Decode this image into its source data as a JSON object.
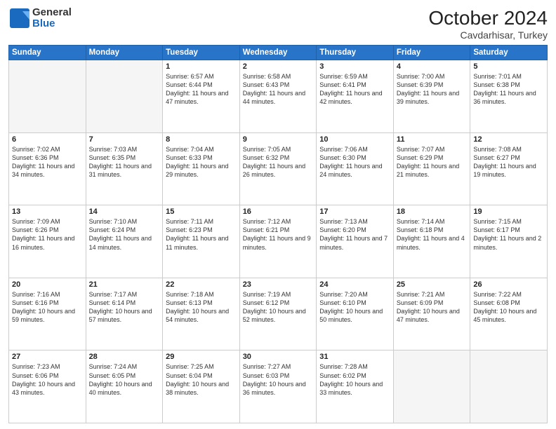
{
  "header": {
    "logo_general": "General",
    "logo_blue": "Blue",
    "month_title": "October 2024",
    "location": "Cavdarhisar, Turkey"
  },
  "weekdays": [
    "Sunday",
    "Monday",
    "Tuesday",
    "Wednesday",
    "Thursday",
    "Friday",
    "Saturday"
  ],
  "weeks": [
    [
      {
        "day": "",
        "sunrise": "",
        "sunset": "",
        "daylight": ""
      },
      {
        "day": "",
        "sunrise": "",
        "sunset": "",
        "daylight": ""
      },
      {
        "day": "1",
        "sunrise": "Sunrise: 6:57 AM",
        "sunset": "Sunset: 6:44 PM",
        "daylight": "Daylight: 11 hours and 47 minutes."
      },
      {
        "day": "2",
        "sunrise": "Sunrise: 6:58 AM",
        "sunset": "Sunset: 6:43 PM",
        "daylight": "Daylight: 11 hours and 44 minutes."
      },
      {
        "day": "3",
        "sunrise": "Sunrise: 6:59 AM",
        "sunset": "Sunset: 6:41 PM",
        "daylight": "Daylight: 11 hours and 42 minutes."
      },
      {
        "day": "4",
        "sunrise": "Sunrise: 7:00 AM",
        "sunset": "Sunset: 6:39 PM",
        "daylight": "Daylight: 11 hours and 39 minutes."
      },
      {
        "day": "5",
        "sunrise": "Sunrise: 7:01 AM",
        "sunset": "Sunset: 6:38 PM",
        "daylight": "Daylight: 11 hours and 36 minutes."
      }
    ],
    [
      {
        "day": "6",
        "sunrise": "Sunrise: 7:02 AM",
        "sunset": "Sunset: 6:36 PM",
        "daylight": "Daylight: 11 hours and 34 minutes."
      },
      {
        "day": "7",
        "sunrise": "Sunrise: 7:03 AM",
        "sunset": "Sunset: 6:35 PM",
        "daylight": "Daylight: 11 hours and 31 minutes."
      },
      {
        "day": "8",
        "sunrise": "Sunrise: 7:04 AM",
        "sunset": "Sunset: 6:33 PM",
        "daylight": "Daylight: 11 hours and 29 minutes."
      },
      {
        "day": "9",
        "sunrise": "Sunrise: 7:05 AM",
        "sunset": "Sunset: 6:32 PM",
        "daylight": "Daylight: 11 hours and 26 minutes."
      },
      {
        "day": "10",
        "sunrise": "Sunrise: 7:06 AM",
        "sunset": "Sunset: 6:30 PM",
        "daylight": "Daylight: 11 hours and 24 minutes."
      },
      {
        "day": "11",
        "sunrise": "Sunrise: 7:07 AM",
        "sunset": "Sunset: 6:29 PM",
        "daylight": "Daylight: 11 hours and 21 minutes."
      },
      {
        "day": "12",
        "sunrise": "Sunrise: 7:08 AM",
        "sunset": "Sunset: 6:27 PM",
        "daylight": "Daylight: 11 hours and 19 minutes."
      }
    ],
    [
      {
        "day": "13",
        "sunrise": "Sunrise: 7:09 AM",
        "sunset": "Sunset: 6:26 PM",
        "daylight": "Daylight: 11 hours and 16 minutes."
      },
      {
        "day": "14",
        "sunrise": "Sunrise: 7:10 AM",
        "sunset": "Sunset: 6:24 PM",
        "daylight": "Daylight: 11 hours and 14 minutes."
      },
      {
        "day": "15",
        "sunrise": "Sunrise: 7:11 AM",
        "sunset": "Sunset: 6:23 PM",
        "daylight": "Daylight: 11 hours and 11 minutes."
      },
      {
        "day": "16",
        "sunrise": "Sunrise: 7:12 AM",
        "sunset": "Sunset: 6:21 PM",
        "daylight": "Daylight: 11 hours and 9 minutes."
      },
      {
        "day": "17",
        "sunrise": "Sunrise: 7:13 AM",
        "sunset": "Sunset: 6:20 PM",
        "daylight": "Daylight: 11 hours and 7 minutes."
      },
      {
        "day": "18",
        "sunrise": "Sunrise: 7:14 AM",
        "sunset": "Sunset: 6:18 PM",
        "daylight": "Daylight: 11 hours and 4 minutes."
      },
      {
        "day": "19",
        "sunrise": "Sunrise: 7:15 AM",
        "sunset": "Sunset: 6:17 PM",
        "daylight": "Daylight: 11 hours and 2 minutes."
      }
    ],
    [
      {
        "day": "20",
        "sunrise": "Sunrise: 7:16 AM",
        "sunset": "Sunset: 6:16 PM",
        "daylight": "Daylight: 10 hours and 59 minutes."
      },
      {
        "day": "21",
        "sunrise": "Sunrise: 7:17 AM",
        "sunset": "Sunset: 6:14 PM",
        "daylight": "Daylight: 10 hours and 57 minutes."
      },
      {
        "day": "22",
        "sunrise": "Sunrise: 7:18 AM",
        "sunset": "Sunset: 6:13 PM",
        "daylight": "Daylight: 10 hours and 54 minutes."
      },
      {
        "day": "23",
        "sunrise": "Sunrise: 7:19 AM",
        "sunset": "Sunset: 6:12 PM",
        "daylight": "Daylight: 10 hours and 52 minutes."
      },
      {
        "day": "24",
        "sunrise": "Sunrise: 7:20 AM",
        "sunset": "Sunset: 6:10 PM",
        "daylight": "Daylight: 10 hours and 50 minutes."
      },
      {
        "day": "25",
        "sunrise": "Sunrise: 7:21 AM",
        "sunset": "Sunset: 6:09 PM",
        "daylight": "Daylight: 10 hours and 47 minutes."
      },
      {
        "day": "26",
        "sunrise": "Sunrise: 7:22 AM",
        "sunset": "Sunset: 6:08 PM",
        "daylight": "Daylight: 10 hours and 45 minutes."
      }
    ],
    [
      {
        "day": "27",
        "sunrise": "Sunrise: 7:23 AM",
        "sunset": "Sunset: 6:06 PM",
        "daylight": "Daylight: 10 hours and 43 minutes."
      },
      {
        "day": "28",
        "sunrise": "Sunrise: 7:24 AM",
        "sunset": "Sunset: 6:05 PM",
        "daylight": "Daylight: 10 hours and 40 minutes."
      },
      {
        "day": "29",
        "sunrise": "Sunrise: 7:25 AM",
        "sunset": "Sunset: 6:04 PM",
        "daylight": "Daylight: 10 hours and 38 minutes."
      },
      {
        "day": "30",
        "sunrise": "Sunrise: 7:27 AM",
        "sunset": "Sunset: 6:03 PM",
        "daylight": "Daylight: 10 hours and 36 minutes."
      },
      {
        "day": "31",
        "sunrise": "Sunrise: 7:28 AM",
        "sunset": "Sunset: 6:02 PM",
        "daylight": "Daylight: 10 hours and 33 minutes."
      },
      {
        "day": "",
        "sunrise": "",
        "sunset": "",
        "daylight": ""
      },
      {
        "day": "",
        "sunrise": "",
        "sunset": "",
        "daylight": ""
      }
    ]
  ]
}
